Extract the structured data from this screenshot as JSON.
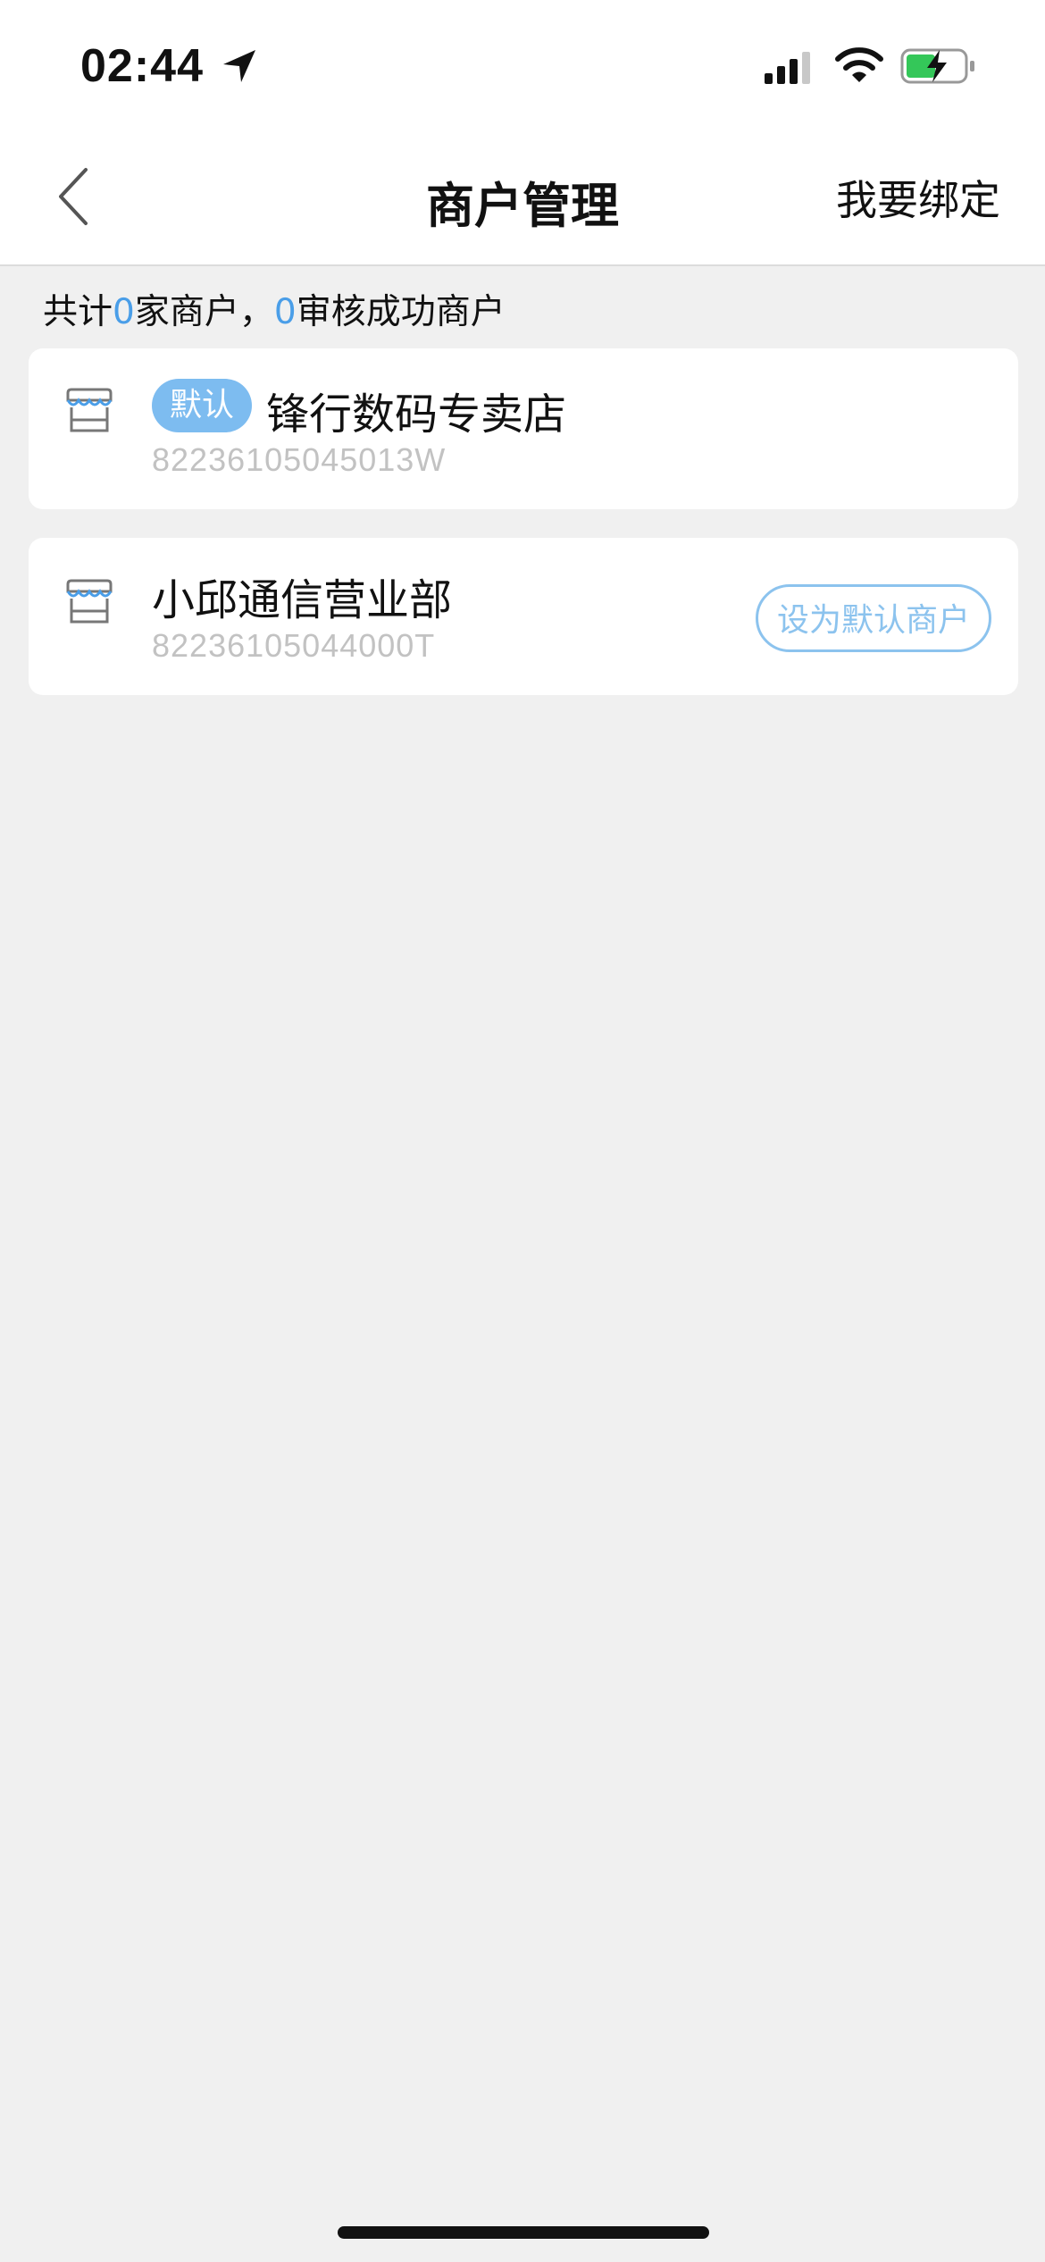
{
  "status_bar": {
    "time": "02:44"
  },
  "nav": {
    "title": "商户管理",
    "bind_label": "我要绑定"
  },
  "summary": {
    "prefix": "共计",
    "merchant_count": "0",
    "middle": "家商户，",
    "approved_count": "0",
    "suffix": "审核成功商户"
  },
  "merchants": [
    {
      "badge": "默认",
      "name": "锋行数码专卖店",
      "id": "82236105045013W"
    },
    {
      "name": "小邱通信营业部",
      "id": "82236105044000T",
      "action_label": "设为默认商户"
    }
  ],
  "colors": {
    "accent": "#4a9ee8",
    "badge_bg": "#7dbcf0",
    "button_border": "#8cc3ee",
    "page_bg": "#f0f0f0"
  }
}
